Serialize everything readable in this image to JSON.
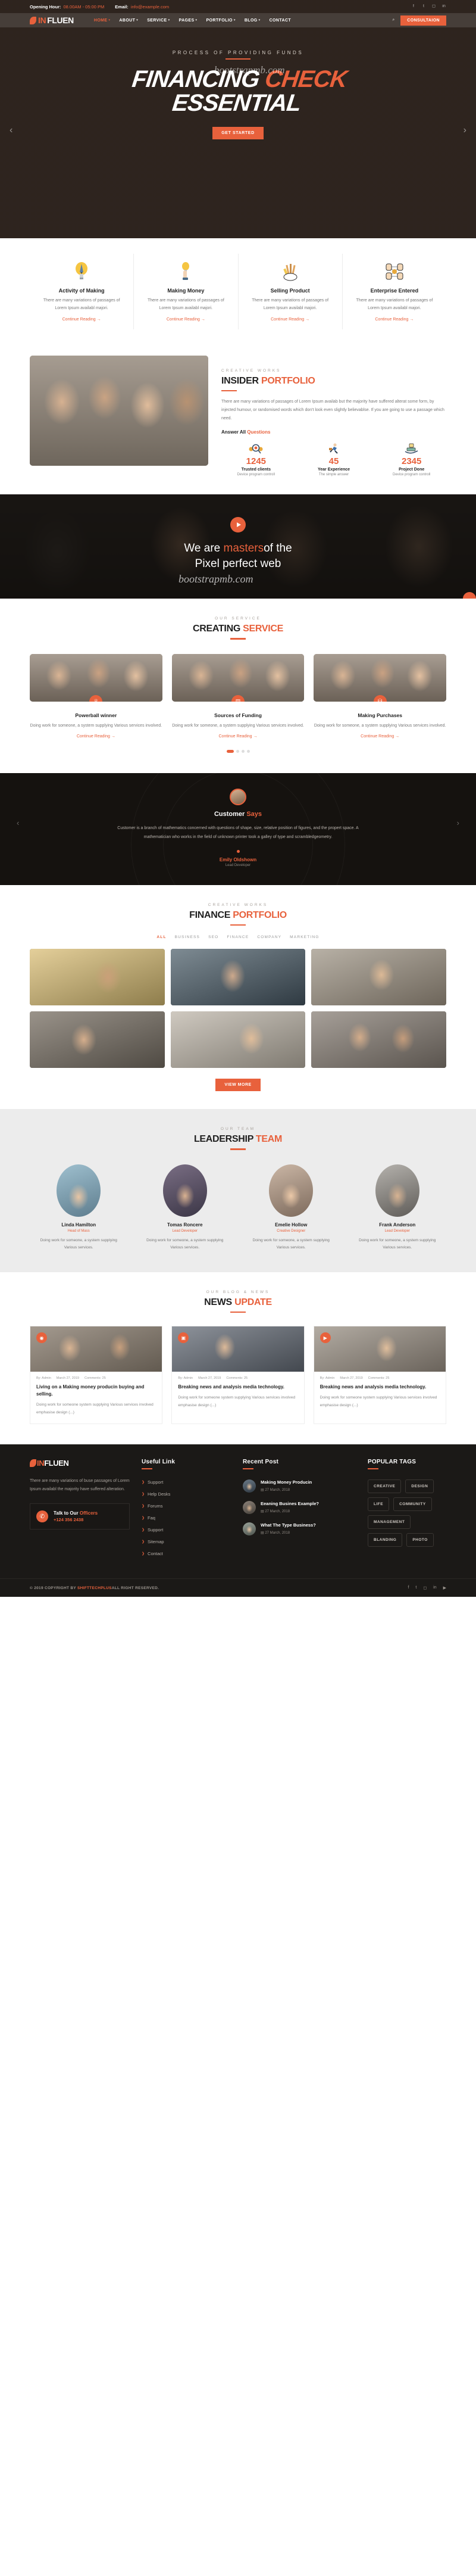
{
  "topbar": {
    "hours_label": "Opening Hour:",
    "hours_value": "08.00AM - 05:00 PM",
    "email_label": "Email:",
    "email_value": "info@example.com",
    "socials": [
      "facebook-icon",
      "twitter-icon",
      "instagram-icon",
      "linkedin-icon"
    ]
  },
  "nav": {
    "logo_a": "IN",
    "logo_b": "FLUEN",
    "items": [
      {
        "label": "HOME",
        "active": true
      },
      {
        "label": "ABOUT",
        "active": false
      },
      {
        "label": "SERVICE",
        "active": false
      },
      {
        "label": "PAGES",
        "active": false
      },
      {
        "label": "PORTFOLIO",
        "active": false
      },
      {
        "label": "BLOG",
        "active": false
      },
      {
        "label": "CONTACT",
        "active": false
      }
    ],
    "consult_label": "CONSULTAION"
  },
  "hero": {
    "eyebrow": "PROCESS OF PROVIDING FUNDS",
    "line1_white": "FINANCING ",
    "line1_accent": "CHECK",
    "line2": "ESSENTIAL",
    "cta": "GET STARTED",
    "watermark": "bootstrapmb.com"
  },
  "features": [
    {
      "icon": "lightbulb-pencil-icon",
      "title": "Activity of Making",
      "text": "There are many variations of passages of Lorem Ipsum availabl majori.",
      "link": "Continue Reading"
    },
    {
      "icon": "hand-idea-icon",
      "title": "Making Money",
      "text": "There are many variations of passages of Lorem Ipsum availabl majori.",
      "link": "Continue Reading"
    },
    {
      "icon": "brushes-icon",
      "title": "Selling Product",
      "text": "There are many variations of passages of Lorem Ipsum availabl majori.",
      "link": "Continue Reading"
    },
    {
      "icon": "network-people-icon",
      "title": "Enterprise Entered",
      "text": "There are many variations of passages of Lorem Ipsum availabl majori.",
      "link": "Continue Reading"
    }
  ],
  "about": {
    "eyebrow": "CREATIVE WORKS",
    "title_dark": "INSIDER ",
    "title_accent": "PORTFOLIO",
    "paragraph": "There are many variations of passages of Lorem Ipsum availab but the majority have suffered alterat some form, by injected humour, or randomised words which don't look even slightly believablse. If you are going to use a passage which need.",
    "answer_dark": "Answer All ",
    "answer_accent": "Questions",
    "stats": [
      {
        "icon": "search-people-icon",
        "number": "1245",
        "label": "Trusted clients",
        "sub": "Device program controll"
      },
      {
        "icon": "runner-icon",
        "number": "45",
        "label": "Year Experience",
        "sub": "The simple answer"
      },
      {
        "icon": "money-hand-icon",
        "number": "2345",
        "label": "Project Done",
        "sub": "Device program controll"
      }
    ]
  },
  "masters": {
    "line1_a": "We are ",
    "line1_accent": "masters",
    "line1_b": "of the",
    "line2": "Pixel perfect web",
    "watermark": "bootstrapmb.com",
    "play_icon": "play-icon"
  },
  "service": {
    "eyebrow": "OUR SERVICE",
    "title_dark": "CREATING ",
    "title_accent": "SERVICE",
    "cards": [
      {
        "badge_icon": "trophy-icon",
        "title": "Powerball winner",
        "text": "Doing work for someone, a system supplying Various services involved.",
        "link": "Continue Reading"
      },
      {
        "badge_icon": "briefcase-icon",
        "title": "Sources of Funding",
        "text": "Doing work for someone, a system supplying Various services involved.",
        "link": "Continue Reading"
      },
      {
        "badge_icon": "cart-icon",
        "title": "Making Purchases",
        "text": "Doing work for someone, a system supplying Various services involved.",
        "link": "Continue Reading"
      }
    ],
    "dots": 4,
    "active_dot": 1
  },
  "testimonial": {
    "avatar": "user-avatar",
    "title_white": "Customer ",
    "title_accent": "Says",
    "quote": "Customer is a branch of mathematics concerned with questions of shape, size, relative position of figures, and the propert space. A mathematician who works in the field of unknown printer took a galley of type and scrambledgeometry.",
    "name": "Emily Oldshown",
    "role": "Lead Developer",
    "prev_icon": "chevron-left-icon",
    "next_icon": "chevron-right-icon"
  },
  "portfolio": {
    "eyebrow": "CREATIVE WORKS",
    "title_dark": "FINANCE ",
    "title_accent": "PORTFOLIO",
    "filters": [
      {
        "label": "ALL",
        "active": true
      },
      {
        "label": "BUSINESS",
        "active": false
      },
      {
        "label": "SEO",
        "active": false
      },
      {
        "label": "FINANCE",
        "active": false
      },
      {
        "label": "COMPANY",
        "active": false
      },
      {
        "label": "MARKETING",
        "active": false
      }
    ],
    "items": [
      "portfolio-item-1",
      "portfolio-item-2",
      "portfolio-item-3",
      "portfolio-item-4",
      "portfolio-item-5",
      "portfolio-item-6"
    ],
    "more_label": "VIEW MORE"
  },
  "team": {
    "eyebrow": "OUR TEAM",
    "title_dark": "LEADERSHIP ",
    "title_accent": "TEAM",
    "members": [
      {
        "name": "Linda Hamilton",
        "role": "Head of Mass",
        "text": "Doing work for someone, a system supplying Various services."
      },
      {
        "name": "Tomas Roncere",
        "role": "Lead Developer",
        "text": "Doing work for someone, a system supplying Various services."
      },
      {
        "name": "Emelie Hollow",
        "role": "Creative Designer",
        "text": "Doing work for someone, a system supplying Various services."
      },
      {
        "name": "Frank Anderson",
        "role": "Lead Developer",
        "text": "Doing work for someone, a system supplying Various services."
      }
    ]
  },
  "news": {
    "eyebrow": "OUR BLOG & NEWS",
    "title_dark": "NEWS ",
    "title_accent": "UPDATE",
    "posts": [
      {
        "badge_icon": "camera-icon",
        "author": "By: Admin",
        "date": "March 27, 2019",
        "comments": "Comments: 25",
        "title": "Living on a Making money producin buying and selling.",
        "text": "Doing work for someone system supplying Various services involved emphasise design (...)"
      },
      {
        "badge_icon": "image-icon",
        "author": "By: Admin",
        "date": "March 27, 2019",
        "comments": "Comments: 25",
        "title": "Breaking news and analysis media technology.",
        "text": "Doing work for someone system supplying Various services involved emphasise design (...)"
      },
      {
        "badge_icon": "video-icon",
        "author": "By: Admin",
        "date": "March 27, 2019",
        "comments": "Comments: 25",
        "title": "Breaking news and analysis media technology.",
        "text": "Doing work for someone system supplying Various services involved emphasise design (...)"
      }
    ]
  },
  "footer": {
    "logo_a": "IN",
    "logo_b": "FLUEN",
    "about_text": "There are many variations of buse passages of Lorem Ipsum availabl the majority have suffered alteration.",
    "call_title_dark": "Talk to Our ",
    "call_title_accent": "Officers",
    "call_number": "+124 356 2438",
    "useful_heading": "Useful Link",
    "useful_links": [
      "Support",
      "Help Desks",
      "Forums",
      "Faq",
      "Support",
      "Sitemap",
      "Contact"
    ],
    "recent_heading": "Recent Post",
    "recent_posts": [
      {
        "title": "Making Money Producin",
        "date": "27 March, 2018"
      },
      {
        "title": "Eeaning Busines Example?",
        "date": "27 March, 2018"
      },
      {
        "title": "What The Type Business?",
        "date": "27 March, 2018"
      }
    ],
    "tags_heading": "POPULAR TAGS",
    "tags": [
      "CREATIVE",
      "DESIGN",
      "LIFE",
      "COMMUNITY",
      "MANAGEMENT",
      "BLANDING",
      "PHOTO"
    ],
    "copyright_a": "© 2019 COPYRIGHT BY ",
    "copyright_accent": "SHIFTTECHPLUS",
    "copyright_b": "ALL RIGHT RESERVED.",
    "socials": [
      "facebook-icon",
      "twitter-icon",
      "instagram-icon",
      "linkedin-icon",
      "youtube-icon"
    ]
  },
  "colors": {
    "accent": "#e8613c",
    "dark": "#1b1917",
    "muted": "#777777"
  }
}
